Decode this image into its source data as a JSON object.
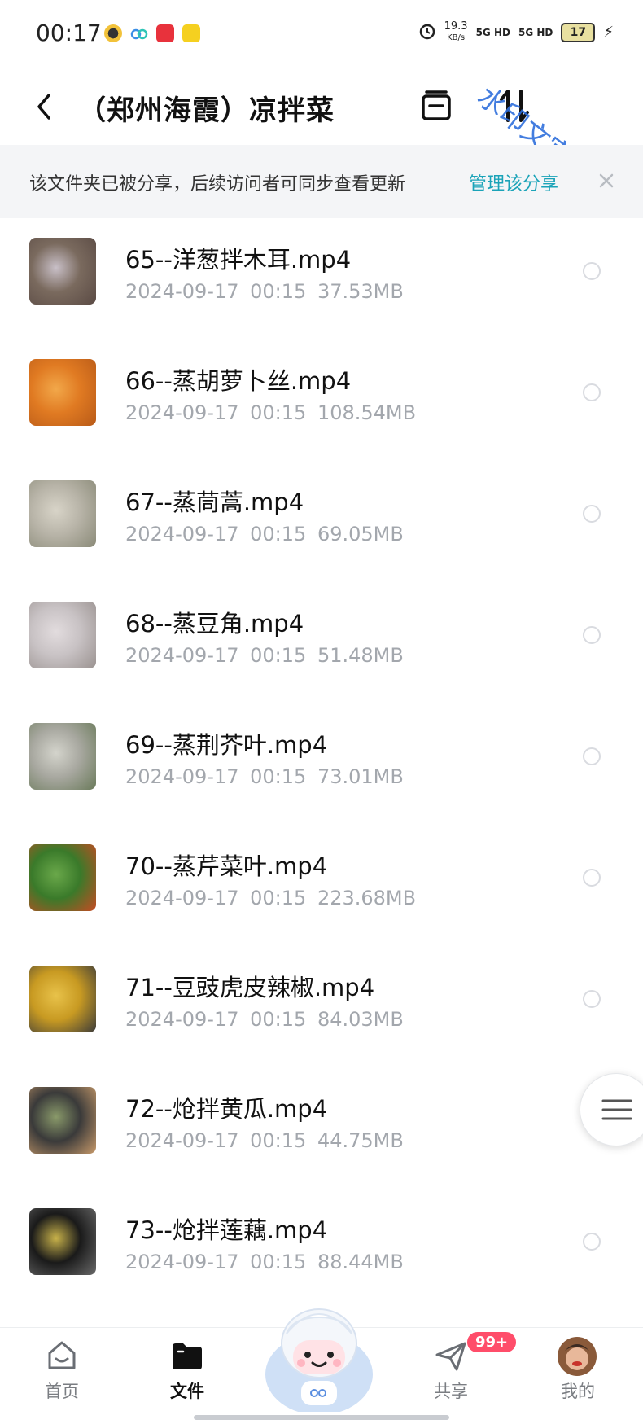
{
  "status_bar": {
    "time": "00:17",
    "net_speed_value": "19.3",
    "net_speed_unit": "KB/s",
    "signal_1": "5G HD",
    "signal_2": "5G HD",
    "battery": "17"
  },
  "header": {
    "title": "（郑州海霞）凉拌菜",
    "watermark": "水印文字"
  },
  "share_banner": {
    "text": "该文件夹已被分享，后续访问者可同步查看更新",
    "link": "管理该分享"
  },
  "files": [
    {
      "name": "65--洋葱拌木耳.mp4",
      "date": "2024-09-17",
      "time": "00:15",
      "size": "37.53MB",
      "thumb_colors": [
        "#7a6a5e",
        "#c9c0c8",
        "#5a4a44"
      ]
    },
    {
      "name": "66--蒸胡萝卜丝.mp4",
      "date": "2024-09-17",
      "time": "00:15",
      "size": "108.54MB",
      "thumb_colors": [
        "#e07a22",
        "#f2a84a",
        "#b85a18"
      ]
    },
    {
      "name": "67--蒸茼蒿.mp4",
      "date": "2024-09-17",
      "time": "00:15",
      "size": "69.05MB",
      "thumb_colors": [
        "#b8b4a8",
        "#d8d4c8",
        "#8a8a78"
      ]
    },
    {
      "name": "68--蒸豆角.mp4",
      "date": "2024-09-17",
      "time": "00:15",
      "size": "51.48MB",
      "thumb_colors": [
        "#c8c2c4",
        "#e2dcde",
        "#9a9290"
      ]
    },
    {
      "name": "69--蒸荆芥叶.mp4",
      "date": "2024-09-17",
      "time": "00:15",
      "size": "73.01MB",
      "thumb_colors": [
        "#a8a8a0",
        "#d4d4cc",
        "#6a7a5a"
      ]
    },
    {
      "name": "70--蒸芹菜叶.mp4",
      "date": "2024-09-17",
      "time": "00:15",
      "size": "223.68MB",
      "thumb_colors": [
        "#3a7a2a",
        "#6aa84a",
        "#c84a22"
      ]
    },
    {
      "name": "71--豆豉虎皮辣椒.mp4",
      "date": "2024-09-17",
      "time": "00:15",
      "size": "84.03MB",
      "thumb_colors": [
        "#c89a22",
        "#e8c24a",
        "#3a3a3a"
      ]
    },
    {
      "name": "72--炝拌黄瓜.mp4",
      "date": "2024-09-17",
      "time": "00:15",
      "size": "44.75MB",
      "thumb_colors": [
        "#3a3a3a",
        "#8a9a6a",
        "#c89a6a"
      ]
    },
    {
      "name": "73--炝拌莲藕.mp4",
      "date": "2024-09-17",
      "time": "00:15",
      "size": "88.44MB",
      "thumb_colors": [
        "#1a1a1a",
        "#c8b24a",
        "#6a6a6a"
      ]
    }
  ],
  "bottom_nav": {
    "home": "首页",
    "files": "文件",
    "share": "共享",
    "share_badge": "99+",
    "mine": "我的"
  },
  "colors": {
    "accent": "#1aa3b8",
    "banner_bg": "#f4f5f7",
    "meta_text": "#a3a7ad",
    "badge": "#ff4d6a"
  }
}
